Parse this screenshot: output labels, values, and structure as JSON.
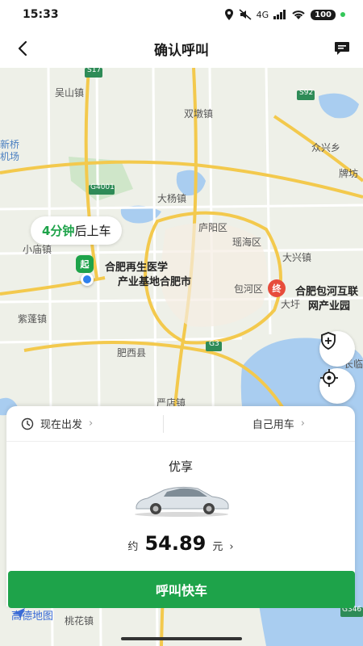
{
  "status_bar": {
    "time": "15:33",
    "network": "4G",
    "battery": "100"
  },
  "nav": {
    "title": "确认呼叫"
  },
  "map": {
    "eta_value": "4分钟",
    "eta_suffix": "后上车",
    "start_label": "起",
    "end_label": "终",
    "start_place": "合肥再生医学",
    "start_place_line2": "产业基地合肥市",
    "end_place": "合肥包河互联",
    "end_place_line2": "网产业园",
    "places": {
      "wushan": "吴山镇",
      "shuangdun": "双墩镇",
      "xinqiao": "新桥",
      "jichang": "机场",
      "zhongxing": "众兴乡",
      "paimen": "牌坊",
      "dayang": "大杨镇",
      "luyang": "庐阳区",
      "xiaomiao": "小庙镇",
      "yaohai": "瑶海区",
      "daxing": "大兴镇",
      "baohe": "包河区",
      "dayu": "大圩",
      "zipeng": "紫蓬镇",
      "feixi": "肥西县",
      "yandian": "严店镇",
      "changlin": "长临",
      "taoxing": "桃花镇",
      "amap": "高德地图"
    },
    "road_badges": {
      "s17": "S17",
      "s92": "S92",
      "g4001": "G4001",
      "g3": "G3",
      "g346": "G346"
    }
  },
  "sheet": {
    "depart_label": "现在出发",
    "passenger_label": "自己用车",
    "car_type": "优享",
    "price_prefix": "约",
    "price_value": "54.89",
    "price_unit": "元",
    "call_button": "呼叫快车"
  },
  "colors": {
    "brand_green": "#1ea34a",
    "end_red": "#e74c3c",
    "location_blue": "#2f80ed"
  }
}
